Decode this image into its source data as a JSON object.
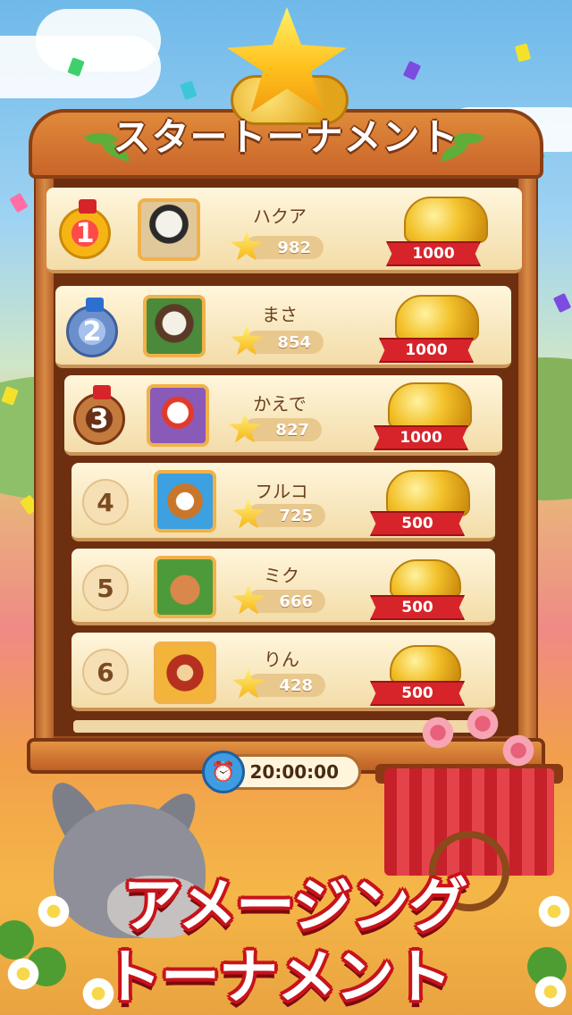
{
  "title": "スタートーナメント",
  "timer": "20:00:00",
  "promo": {
    "line1": "アメージング",
    "line2": "トーナメント"
  },
  "rows": [
    {
      "rank": "1",
      "name": "ハクア",
      "stars": "982",
      "reward": "1000",
      "avatar": "sheep"
    },
    {
      "rank": "2",
      "name": "まさ",
      "stars": "854",
      "reward": "1000",
      "avatar": "cow"
    },
    {
      "rank": "3",
      "name": "かえで",
      "stars": "827",
      "reward": "1000",
      "avatar": "chicken"
    },
    {
      "rank": "4",
      "name": "フルコ",
      "stars": "725",
      "reward": "500",
      "avatar": "dog"
    },
    {
      "rank": "5",
      "name": "ミク",
      "stars": "666",
      "reward": "500",
      "avatar": "kangaroo"
    },
    {
      "rank": "6",
      "name": "りん",
      "stars": "428",
      "reward": "500",
      "avatar": "horse"
    }
  ],
  "colors": {
    "gold": "#f6b515",
    "silver": "#5b86c7",
    "bronze": "#a8582a",
    "ribbon": "#d6242a"
  }
}
